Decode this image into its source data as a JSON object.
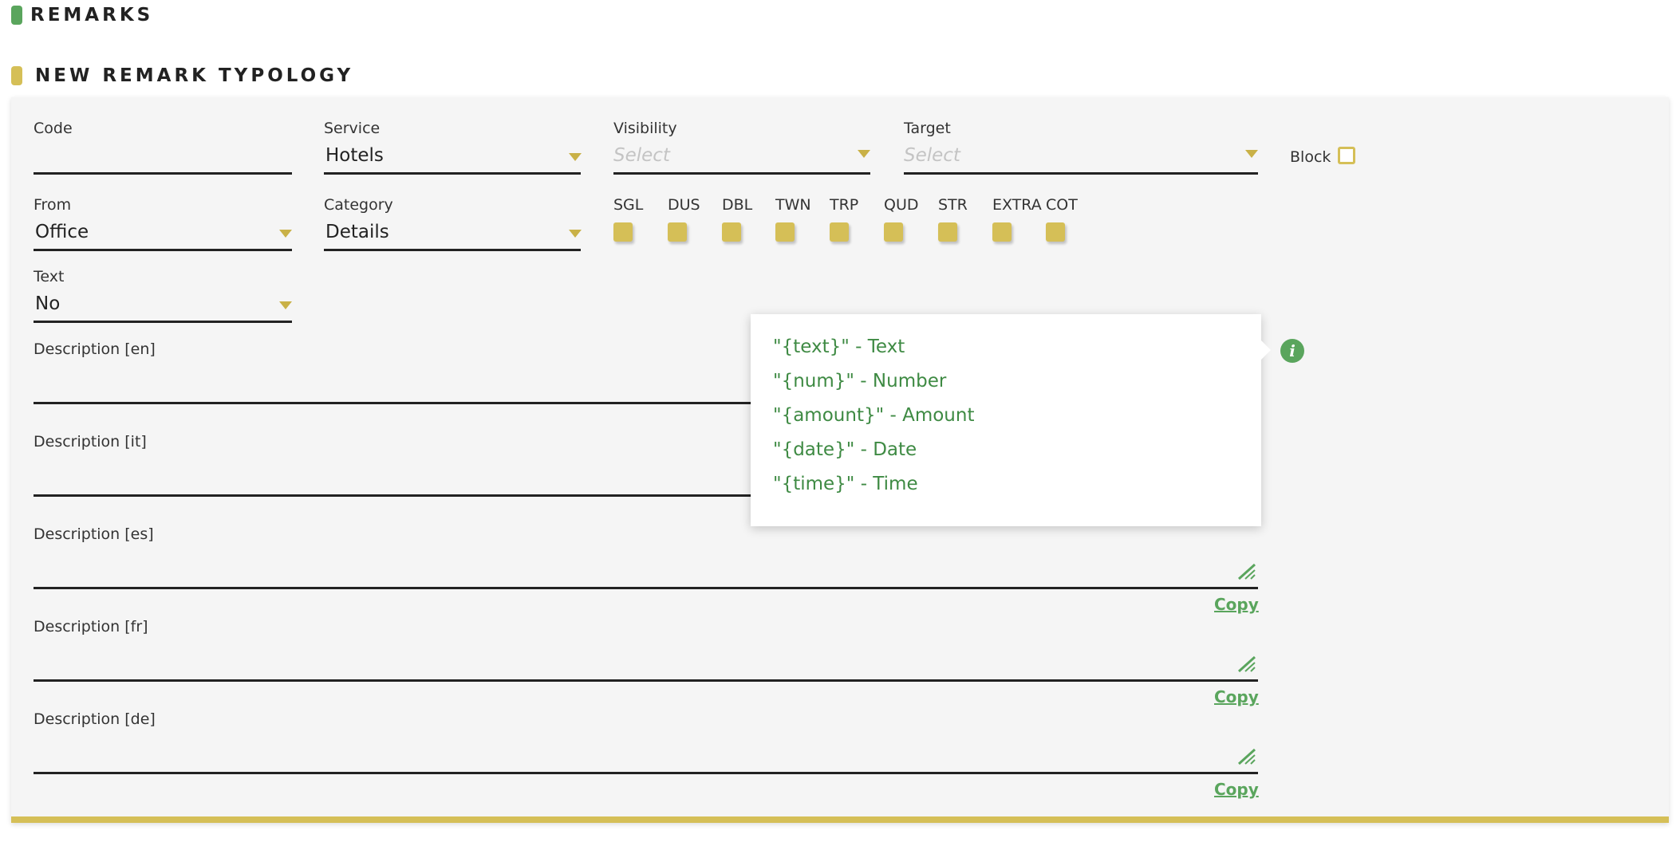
{
  "header": {
    "remarks_title": "REMARKS",
    "new_title": "NEW REMARK TYPOLOGY"
  },
  "form": {
    "code": {
      "label": "Code",
      "value": ""
    },
    "service": {
      "label": "Service",
      "value": "Hotels"
    },
    "visibility": {
      "label": "Visibility",
      "placeholder": "Select"
    },
    "target": {
      "label": "Target",
      "placeholder": "Select"
    },
    "block": {
      "label": "Block"
    },
    "from": {
      "label": "From",
      "value": "Office"
    },
    "category": {
      "label": "Category",
      "value": "Details"
    },
    "room_types": [
      "SGL",
      "DUS",
      "DBL",
      "TWN",
      "TRP",
      "QUD",
      "STR",
      "EXTRA",
      "COT"
    ],
    "text": {
      "label": "Text",
      "value": "No"
    },
    "descriptions": [
      {
        "label": "Description [en]"
      },
      {
        "label": "Description [it]"
      },
      {
        "label": "Description [es]"
      },
      {
        "label": "Description [fr]"
      },
      {
        "label": "Description [de]"
      }
    ],
    "copy_label": "Copy"
  },
  "tooltip": {
    "items": [
      "\"{text}\" - Text",
      "\"{num}\" - Number",
      "\"{amount}\" - Amount",
      "\"{date}\" - Date",
      "\"{time}\" - Time"
    ]
  },
  "icons": {
    "info": "info-icon",
    "resize": "resize-handle-icon",
    "dropdown": "caret-down-icon"
  },
  "colors": {
    "green": "#5aa55d",
    "gold": "#d5bf57",
    "text_green": "#3e8a43"
  }
}
